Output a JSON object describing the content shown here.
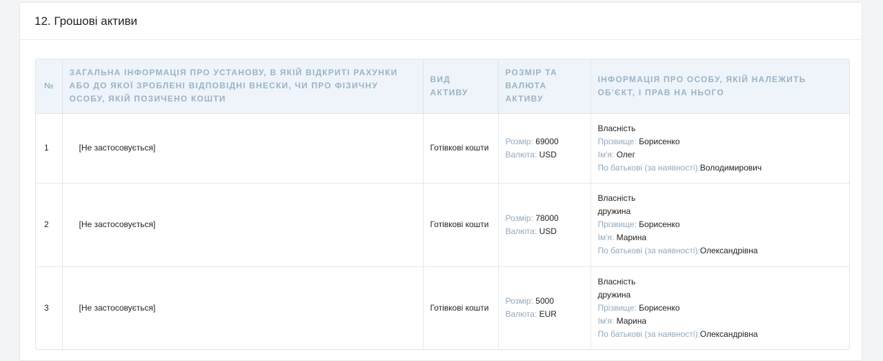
{
  "section": {
    "title": "12. Грошові активи"
  },
  "table": {
    "headers": {
      "num": "№",
      "institution": "ЗАГАЛЬНА ІНФОРМАЦІЯ ПРО УСТАНОВУ, В ЯКІЙ ВІДКРИТІ РАХУНКИ АБО ДО ЯКОЇ ЗРОБЛЕНІ ВІДПОВІДНІ ВНЕСКИ, ЧИ ПРО ФІЗИЧНУ ОСОБУ, ЯКІЙ ПОЗИЧЕНО КОШТИ",
      "asset_type": "ВИД АКТИВУ",
      "size": "РОЗМІР ТА ВАЛЮТА АКТИВУ",
      "owner": "ІНФОРМАЦІЯ ПРО ОСОБУ, ЯКІЙ НАЛЕЖИТЬ ОБ'ЄКТ, І ПРАВ НА НЬОГО"
    },
    "labels": {
      "size": "Розмір:",
      "currency": "Валюта:",
      "surname": "Прізвище:",
      "name": "Ім'я:",
      "patronymic": "По батькові (за наявності):"
    },
    "rows": [
      {
        "num": "1",
        "institution": "[Не застосовується]",
        "asset_type": "Готівкові кошти",
        "size": "69000",
        "currency": "USD",
        "right": "Власність",
        "relation": "",
        "surname": "Борисенко",
        "name": "Олег",
        "patronymic": "Володимирович"
      },
      {
        "num": "2",
        "institution": "[Не застосовується]",
        "asset_type": "Готівкові кошти",
        "size": "78000",
        "currency": "USD",
        "right": "Власність",
        "relation": "дружина",
        "surname": "Борисенко",
        "name": "Марина",
        "patronymic": "Олександрівна"
      },
      {
        "num": "3",
        "institution": "[Не застосовується]",
        "asset_type": "Готівкові кошти",
        "size": "5000",
        "currency": "EUR",
        "right": "Власність",
        "relation": "дружина",
        "surname": "Борисенко",
        "name": "Марина",
        "patronymic": "Олександрівна"
      }
    ]
  }
}
